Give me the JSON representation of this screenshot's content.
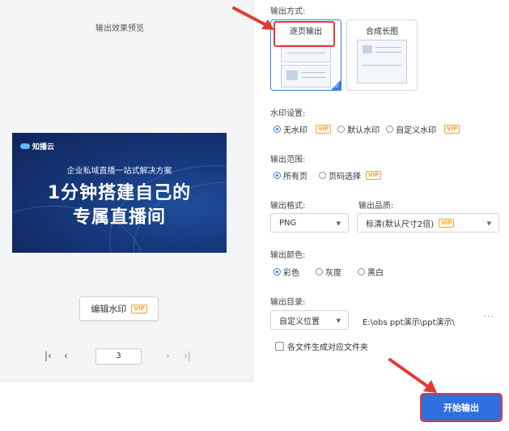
{
  "preview": {
    "title": "输出效果预览",
    "slide": {
      "brand": "知播云",
      "subtitle": "企业私域直播一站式解决方案",
      "headline_line1": "1分钟搭建自己的",
      "headline_line2": "专属直播间"
    },
    "edit_watermark_label": "编辑水印",
    "vip_badge": "VIP",
    "pager": {
      "first_icon": "first-page-icon",
      "prev_icon": "prev-page-icon",
      "current_page": "3",
      "next_icon": "next-page-icon",
      "last_icon": "last-page-icon"
    }
  },
  "settings": {
    "output_mode": {
      "label": "输出方式:",
      "options": [
        "逐页输出",
        "合成长图"
      ],
      "selected": "逐页输出"
    },
    "watermark": {
      "label": "水印设置:",
      "options": [
        "无水印",
        "默认水印",
        "自定义水印"
      ],
      "selected": "无水印"
    },
    "range": {
      "label": "输出范围:",
      "options": [
        "所有页",
        "页码选择"
      ],
      "selected": "所有页"
    },
    "format": {
      "label": "输出格式:",
      "value": "PNG"
    },
    "quality": {
      "label": "输出品质:",
      "value": "标清(默认尺寸2倍)"
    },
    "color": {
      "label": "输出颜色:",
      "options": [
        "彩色",
        "灰度",
        "黑白"
      ],
      "selected": "彩色"
    },
    "directory": {
      "label": "输出目录:",
      "mode": "自定义位置",
      "path": "E:\\obs ppt演示\\ppt演示\\",
      "more": "···"
    },
    "per_file_folder_label": "各文件生成对应文件夹",
    "start_button": "开始输出"
  },
  "colors": {
    "accent": "#3b7ddd",
    "annotation_red": "#e53935",
    "vip_orange": "#f3a640"
  }
}
